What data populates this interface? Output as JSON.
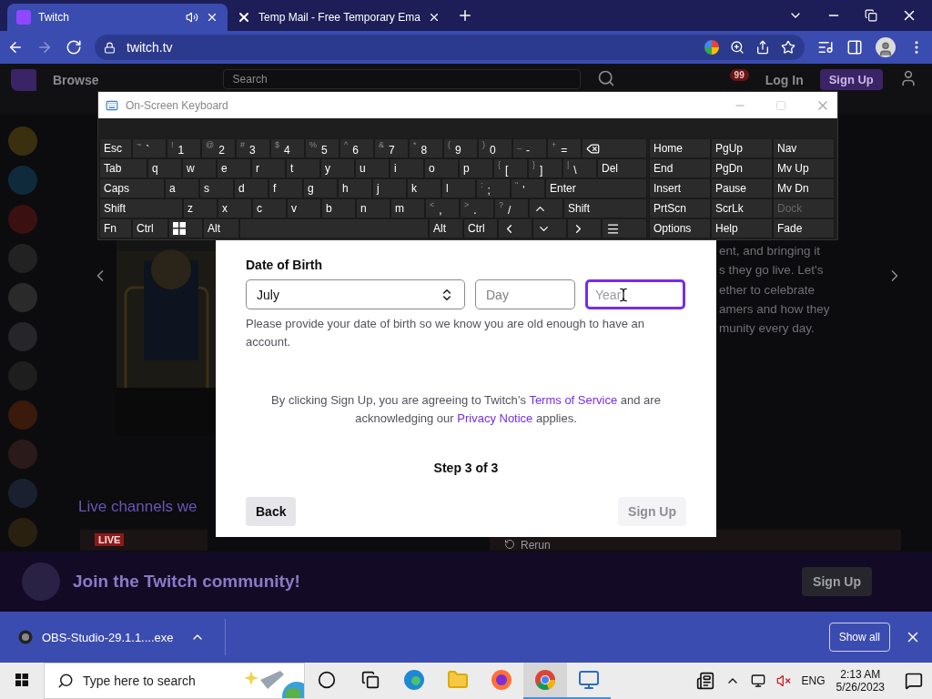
{
  "browser": {
    "tabs": [
      {
        "title": "Twitch",
        "selected": true,
        "audio": true
      },
      {
        "title": "Temp Mail - Free Temporary Ema",
        "selected": false,
        "audio": false
      }
    ],
    "nav_buttons": [
      {
        "kind": "back",
        "disabled": false
      },
      {
        "kind": "forward",
        "disabled": true
      },
      {
        "kind": "reload",
        "disabled": false
      }
    ],
    "address": "twitch.tv"
  },
  "twitch": {
    "nav": {
      "browse": "Browse",
      "search_placeholder": "Search",
      "notification_count": "99",
      "login": "Log In",
      "signup": "Sign Up"
    },
    "feature_text": [
      "ent, and bringing it",
      "s they go live. Let's",
      "ether to celebrate",
      "amers and how they",
      "munity every day."
    ],
    "section_title": "Live channels we",
    "cards": [
      {
        "kind": "live",
        "label": "LIVE"
      },
      {
        "kind": "rerun",
        "label": "Rerun"
      }
    ],
    "banner": {
      "text": "Join the Twitch community!",
      "button": "Sign Up"
    }
  },
  "modal": {
    "dob_label": "Date of Birth",
    "fields": [
      {
        "kind": "select",
        "value": "July"
      },
      {
        "kind": "input",
        "placeholder": "Day",
        "focused": false
      },
      {
        "kind": "input",
        "placeholder": "Year",
        "focused": true
      }
    ],
    "hint": "Please provide your date of birth so we know you are old enough to have an account.",
    "legal": [
      {
        "text": "By clicking Sign Up, you are agreeing to Twitch’s ",
        "link": false
      },
      {
        "text": "Terms of Service",
        "link": true
      },
      {
        "text": " and are acknowledging our ",
        "link": false
      },
      {
        "text": "Privacy Notice",
        "link": true
      },
      {
        "text": " applies.",
        "link": false
      }
    ],
    "step": "Step 3 of 3",
    "back": "Back",
    "submit": {
      "label": "Sign Up",
      "disabled": true
    }
  },
  "osk": {
    "title": "On-Screen Keyboard",
    "rows": [
      {
        "keys": [
          {
            "kind": "text",
            "label": "Esc"
          },
          {
            "kind": "char",
            "shift": "~",
            "label": "`"
          },
          {
            "kind": "char",
            "shift": "!",
            "label": "1"
          },
          {
            "kind": "char",
            "shift": "@",
            "label": "2"
          },
          {
            "kind": "char",
            "shift": "#",
            "label": "3"
          },
          {
            "kind": "char",
            "shift": "$",
            "label": "4"
          },
          {
            "kind": "char",
            "shift": "%",
            "label": "5"
          },
          {
            "kind": "char",
            "shift": "^",
            "label": "6"
          },
          {
            "kind": "char",
            "shift": "&",
            "label": "7"
          },
          {
            "kind": "char",
            "shift": "*",
            "label": "8"
          },
          {
            "kind": "char",
            "shift": "(",
            "label": "9"
          },
          {
            "kind": "char",
            "shift": ")",
            "label": "0"
          },
          {
            "kind": "char",
            "shift": "_",
            "label": "-"
          },
          {
            "kind": "char",
            "shift": "+",
            "label": "="
          },
          {
            "kind": "backspace"
          }
        ]
      },
      {
        "keys": [
          {
            "kind": "text",
            "label": "Tab"
          },
          {
            "kind": "text",
            "label": "q"
          },
          {
            "kind": "text",
            "label": "w"
          },
          {
            "kind": "text",
            "label": "e"
          },
          {
            "kind": "text",
            "label": "r"
          },
          {
            "kind": "text",
            "label": "t"
          },
          {
            "kind": "text",
            "label": "y"
          },
          {
            "kind": "text",
            "label": "u"
          },
          {
            "kind": "text",
            "label": "i"
          },
          {
            "kind": "text",
            "label": "o"
          },
          {
            "kind": "text",
            "label": "p"
          },
          {
            "kind": "char",
            "shift": "{",
            "label": "["
          },
          {
            "kind": "char",
            "shift": "}",
            "label": "]"
          },
          {
            "kind": "char",
            "shift": "|",
            "label": "\\"
          },
          {
            "kind": "text",
            "label": "Del"
          }
        ]
      },
      {
        "keys": [
          {
            "kind": "text",
            "label": "Caps"
          },
          {
            "kind": "text",
            "label": "a"
          },
          {
            "kind": "text",
            "label": "s"
          },
          {
            "kind": "text",
            "label": "d"
          },
          {
            "kind": "text",
            "label": "f"
          },
          {
            "kind": "text",
            "label": "g"
          },
          {
            "kind": "text",
            "label": "h"
          },
          {
            "kind": "text",
            "label": "j"
          },
          {
            "kind": "text",
            "label": "k"
          },
          {
            "kind": "text",
            "label": "l"
          },
          {
            "kind": "char",
            "shift": ":",
            "label": ";"
          },
          {
            "kind": "char",
            "shift": "\"",
            "label": "'"
          },
          {
            "kind": "text",
            "label": "Enter"
          }
        ]
      },
      {
        "keys": [
          {
            "kind": "text",
            "label": "Shift"
          },
          {
            "kind": "text",
            "label": "z"
          },
          {
            "kind": "text",
            "label": "x"
          },
          {
            "kind": "text",
            "label": "c"
          },
          {
            "kind": "text",
            "label": "v"
          },
          {
            "kind": "text",
            "label": "b"
          },
          {
            "kind": "text",
            "label": "n"
          },
          {
            "kind": "text",
            "label": "m"
          },
          {
            "kind": "char",
            "shift": "<",
            "label": ","
          },
          {
            "kind": "char",
            "shift": ">",
            "label": "."
          },
          {
            "kind": "char",
            "shift": "?",
            "label": "/"
          },
          {
            "kind": "up"
          },
          {
            "kind": "text",
            "label": "Shift"
          }
        ]
      },
      {
        "keys": [
          {
            "kind": "text",
            "label": "Fn"
          },
          {
            "kind": "text",
            "label": "Ctrl"
          },
          {
            "kind": "windows"
          },
          {
            "kind": "text",
            "label": "Alt"
          },
          {
            "kind": "space"
          },
          {
            "kind": "text",
            "label": "Alt"
          },
          {
            "kind": "text",
            "label": "Ctrl"
          },
          {
            "kind": "left"
          },
          {
            "kind": "down"
          },
          {
            "kind": "right"
          },
          {
            "kind": "menu"
          }
        ]
      }
    ],
    "nav_keys": [
      [
        {
          "label": "Home",
          "disabled": false
        },
        {
          "label": "PgUp",
          "disabled": false
        },
        {
          "label": "Nav",
          "disabled": false
        }
      ],
      [
        {
          "label": "End",
          "disabled": false
        },
        {
          "label": "PgDn",
          "disabled": false
        },
        {
          "label": "Mv Up",
          "disabled": false
        }
      ],
      [
        {
          "label": "Insert",
          "disabled": false
        },
        {
          "label": "Pause",
          "disabled": false
        },
        {
          "label": "Mv Dn",
          "disabled": false
        }
      ],
      [
        {
          "label": "PrtScn",
          "disabled": false
        },
        {
          "label": "ScrLk",
          "disabled": false
        },
        {
          "label": "Dock",
          "disabled": true
        }
      ],
      [
        {
          "label": "Options",
          "disabled": false
        },
        {
          "label": "Help",
          "disabled": false
        },
        {
          "label": "Fade",
          "disabled": false
        }
      ]
    ]
  },
  "downloads": {
    "items": [
      {
        "name": "OBS-Studio-29.1.1....exe"
      }
    ],
    "show_all": "Show all"
  },
  "taskbar": {
    "search_placeholder": "Type here to search",
    "apps": [
      {
        "kind": "cortana",
        "selected": false,
        "running": false
      },
      {
        "kind": "taskview",
        "selected": false,
        "running": false
      },
      {
        "kind": "edge",
        "selected": false,
        "running": false
      },
      {
        "kind": "explorer",
        "selected": false,
        "running": false
      },
      {
        "kind": "firefox",
        "selected": false,
        "running": false
      },
      {
        "kind": "chrome",
        "selected": true,
        "running": true
      },
      {
        "kind": "remote",
        "selected": false,
        "running": true
      }
    ],
    "tray": {
      "muted": true,
      "language": "ENG",
      "time": "2:13 AM",
      "date": "5/26/2023"
    }
  }
}
